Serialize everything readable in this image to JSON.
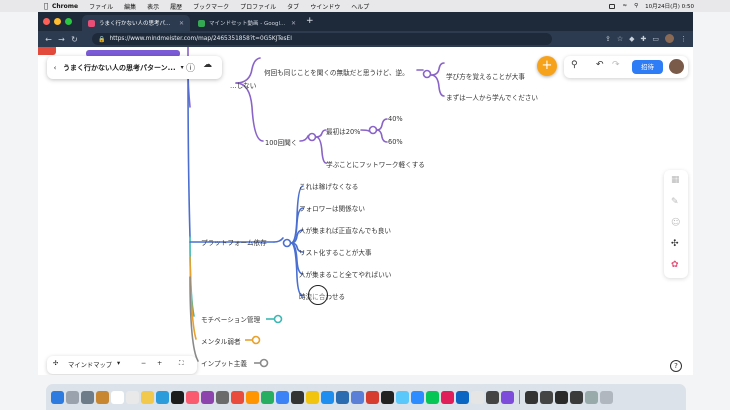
{
  "menubar": {
    "app": "Chrome",
    "items": [
      "ファイル",
      "編集",
      "表示",
      "履歴",
      "ブックマーク",
      "プロファイル",
      "タブ",
      "ウインドウ",
      "ヘルプ"
    ],
    "clock": "10月24日(月)  0:50"
  },
  "browser": {
    "tabs": [
      {
        "label": "うまく行かない人の思考パターン",
        "active": true
      },
      {
        "label": "マインドセット動画 - Google ドライブ",
        "active": false
      }
    ],
    "url": "https://www.mindmeister.com/map/2465351858?t=0G5KJTesEI"
  },
  "map": {
    "title": "うまく行かない人の思考パターン...",
    "share_label": "招待",
    "bottom_mode": "マインドマップ",
    "nodes": {
      "partial_top": "…しない",
      "n_repeat": "何回も同じことを聞くの無駄だと思うけど、逆。",
      "n_learn_way": "学び方を覚えることが大事",
      "n_alone": "まずは一人から学んでください",
      "n_100": "100回聞く",
      "n_first20": "最初は20%",
      "n_40": "40%",
      "n_60": "60%",
      "n_footwork": "学ぶことにフットワーク軽くする",
      "n_platform": "プラットフォーム依存",
      "n_notearn": "これは稼げなくなる",
      "n_followers": "フォロワーは関係ない",
      "n_gather": "人が集まれば正直なんでも良い",
      "n_list": "リスト化することが大事",
      "n_all": "人が集まること全てやればいい",
      "n_timing": "時流に合わせる",
      "n_motivation": "モチベーション管理",
      "n_mental": "メンタル弱者",
      "n_input": "インプット主義"
    }
  },
  "colors": {
    "purple_branch": "#8a63c9",
    "blue_branch": "#4a6fd1",
    "teal_branch": "#3bb8b4",
    "orange_branch": "#e8a12b",
    "gray_branch": "#8a8a8a",
    "accent_plus": "#f7a21b",
    "share_button": "#2f7df6"
  }
}
